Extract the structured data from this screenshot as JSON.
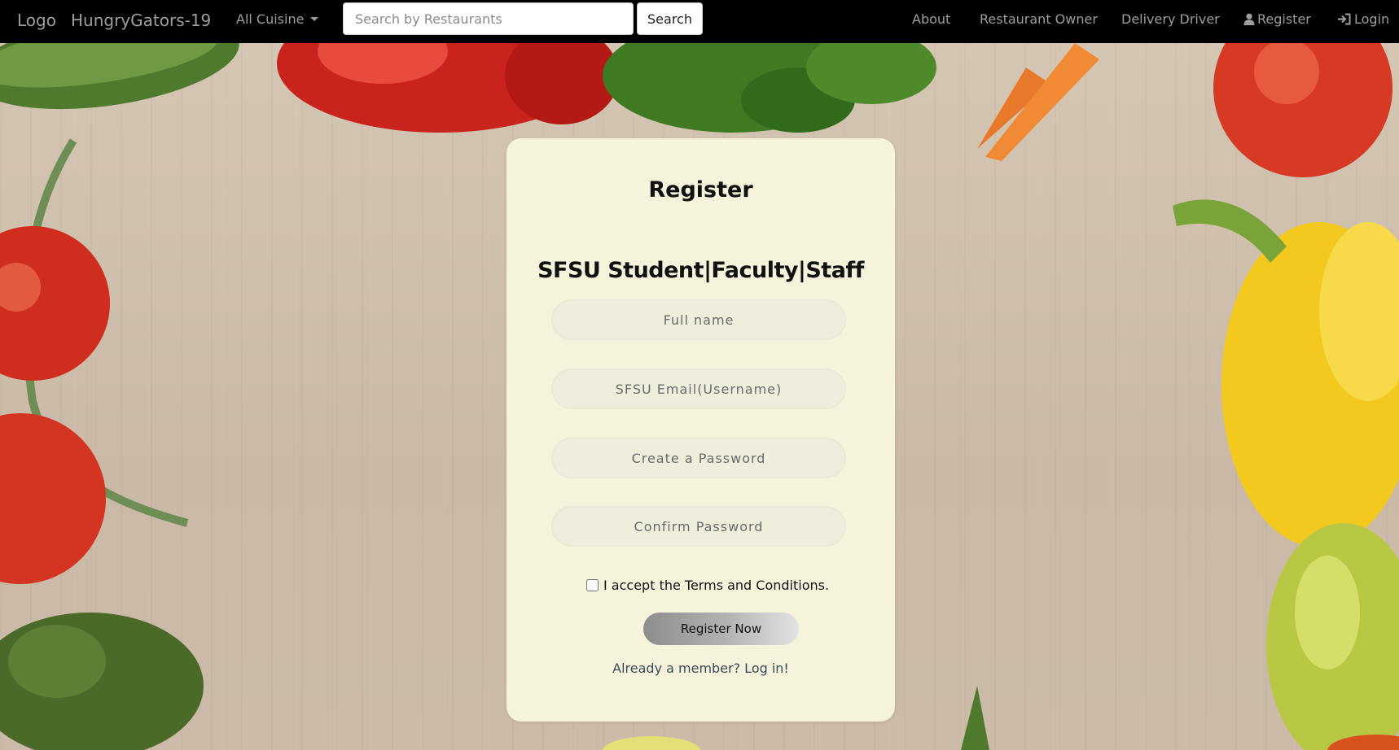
{
  "navbar": {
    "logo": "Logo",
    "brand": "HungryGators-19",
    "cuisine_dropdown": "All Cuisine",
    "search": {
      "placeholder": "Search by Restaurants",
      "button": "Search"
    },
    "links": {
      "about": "About",
      "restaurant_owner": "Restaurant Owner",
      "delivery_driver": "Delivery Driver",
      "register": "Register",
      "login": "Login"
    }
  },
  "form": {
    "title": "Register",
    "subtitle": "SFSU Student|Faculty|Staff",
    "fields": {
      "full_name": "Full name",
      "email": "SFSU Email(Username)",
      "password": "Create a Password",
      "confirm": "Confirm Password"
    },
    "terms_label": "I accept the Terms and Conditions.",
    "submit": "Register Now",
    "login_prompt": "Already a member? Log in!"
  },
  "icons": {
    "register": "user-icon",
    "login": "sign-in-icon",
    "dropdown": "caret-down-icon"
  },
  "colors": {
    "navbar_bg": "#000000",
    "card_bg": "#f6f3dc",
    "field_bg": "#efeddb",
    "nav_text": "#9d9d9d"
  }
}
